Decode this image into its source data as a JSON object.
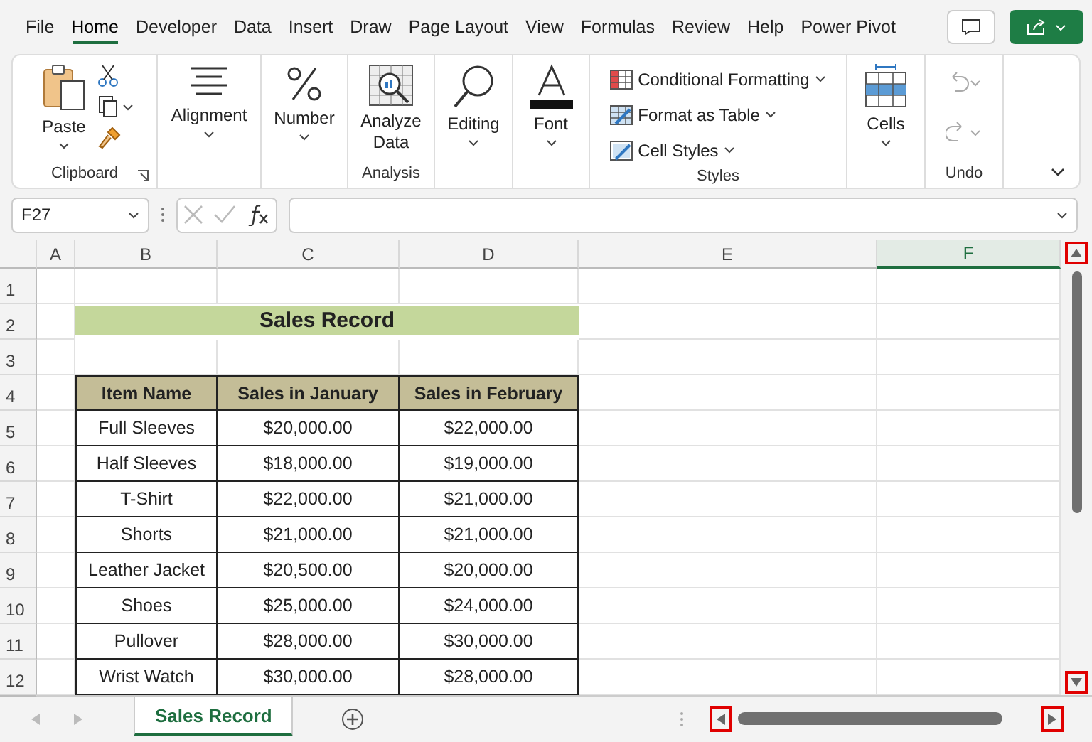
{
  "menu_tabs": [
    {
      "label": "File",
      "selected": false
    },
    {
      "label": "Home",
      "selected": true
    },
    {
      "label": "Developer",
      "selected": false
    },
    {
      "label": "Data",
      "selected": false
    },
    {
      "label": "Insert",
      "selected": false
    },
    {
      "label": "Draw",
      "selected": false
    },
    {
      "label": "Page Layout",
      "selected": false
    },
    {
      "label": "View",
      "selected": false
    },
    {
      "label": "Formulas",
      "selected": false
    },
    {
      "label": "Review",
      "selected": false
    },
    {
      "label": "Help",
      "selected": false
    },
    {
      "label": "Power Pivot",
      "selected": false
    }
  ],
  "ribbon": [
    {
      "kind": "clipboard",
      "label": "Clipboard",
      "buttons": [
        {
          "label": "Paste",
          "dropdown": true
        }
      ]
    },
    {
      "kind": "large",
      "buttons": [
        {
          "label": "Alignment",
          "dropdown": true
        }
      ]
    },
    {
      "kind": "large",
      "buttons": [
        {
          "label": "Number",
          "dropdown": true
        }
      ]
    },
    {
      "kind": "large",
      "label": "Analysis",
      "buttons": [
        {
          "label": "Analyze Data",
          "dropdown": false
        }
      ]
    },
    {
      "kind": "large",
      "buttons": [
        {
          "label": "Editing",
          "dropdown": true
        }
      ]
    },
    {
      "kind": "large",
      "buttons": [
        {
          "label": "Font",
          "dropdown": true
        }
      ]
    },
    {
      "kind": "list",
      "label": "Styles",
      "buttons": [
        {
          "label": "Conditional Formatting",
          "dropdown": true
        },
        {
          "label": "Format as Table",
          "dropdown": true
        },
        {
          "label": "Cell Styles",
          "dropdown": true
        }
      ]
    },
    {
      "kind": "large",
      "buttons": [
        {
          "label": "Cells",
          "dropdown": true
        }
      ]
    },
    {
      "kind": "undo",
      "label": "Undo",
      "disabled": true
    }
  ],
  "name_box": "F27",
  "sheet": {
    "columns": [
      {
        "label": "A",
        "selected": false
      },
      {
        "label": "B",
        "selected": false
      },
      {
        "label": "C",
        "selected": false
      },
      {
        "label": "D",
        "selected": false
      },
      {
        "label": "E",
        "selected": false
      },
      {
        "label": "F",
        "selected": true
      }
    ],
    "rows": [
      "1",
      "2",
      "3",
      "4",
      "5",
      "6",
      "7",
      "8",
      "9",
      "10",
      "11",
      "12"
    ],
    "title": "Sales Record",
    "table": {
      "columns": [
        "Item Name",
        "Sales in January",
        "Sales in February"
      ],
      "rows": [
        [
          "Full Sleeves",
          "$20,000.00",
          "$22,000.00"
        ],
        [
          "Half Sleeves",
          "$18,000.00",
          "$19,000.00"
        ],
        [
          "T-Shirt",
          "$22,000.00",
          "$21,000.00"
        ],
        [
          "Shorts",
          "$21,000.00",
          "$21,000.00"
        ],
        [
          "Leather Jacket",
          "$20,500.00",
          "$20,000.00"
        ],
        [
          "Shoes",
          "$25,000.00",
          "$24,000.00"
        ],
        [
          "Pullover",
          "$28,000.00",
          "$30,000.00"
        ],
        [
          "Wrist Watch",
          "$30,000.00",
          "$28,000.00"
        ]
      ]
    }
  },
  "sheet_tabs": [
    {
      "label": "Sales Record",
      "selected": true
    }
  ],
  "scroll_arrows": {
    "highlighted": true
  }
}
